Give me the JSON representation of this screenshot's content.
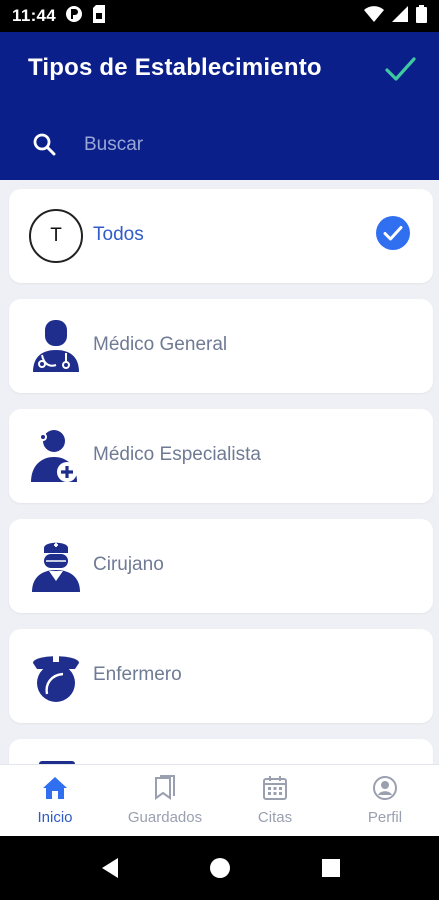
{
  "status_bar": {
    "time": "11:44",
    "left_icons": [
      "data-saver-icon",
      "sim-card-icon"
    ],
    "right_icons": [
      "wifi-icon",
      "signal-icon",
      "battery-icon"
    ]
  },
  "header": {
    "title": "Tipos de Establecimiento",
    "confirm_icon": "check-icon",
    "search_placeholder": "Buscar",
    "search_value": ""
  },
  "colors": {
    "header_bg": "#0b1f8a",
    "accent_blue": "#2f5cc8",
    "confirm_green": "#3fc9a0",
    "icon_navy": "#1f2e8c",
    "list_bg": "#eef0f5"
  },
  "items": [
    {
      "label": "Todos",
      "avatar_letter": "T",
      "selected": true
    },
    {
      "label": "Médico General",
      "icon": "general-doctor-icon",
      "selected": false
    },
    {
      "label": "Médico Especialista",
      "icon": "specialist-doctor-icon",
      "selected": false
    },
    {
      "label": "Cirujano",
      "icon": "surgeon-icon",
      "selected": false
    },
    {
      "label": "Enfermero",
      "icon": "nurse-icon",
      "selected": false
    },
    {
      "label": "",
      "icon": "partial-item-icon",
      "selected": false
    }
  ],
  "bottom_nav": [
    {
      "label": "Inicio",
      "icon": "home-icon",
      "active": true
    },
    {
      "label": "Guardados",
      "icon": "bookmark-icon",
      "active": false
    },
    {
      "label": "Citas",
      "icon": "calendar-icon",
      "active": false
    },
    {
      "label": "Perfil",
      "icon": "profile-icon",
      "active": false
    }
  ]
}
